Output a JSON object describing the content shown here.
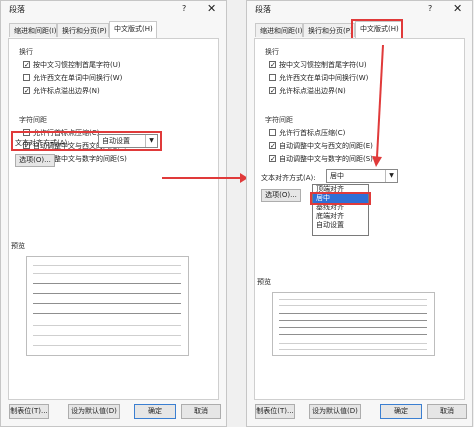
{
  "dialog_title": "段落",
  "help": "?",
  "close": "✕",
  "tabs": [
    "缩进和间距(I)",
    "换行和分页(P)",
    "中文版式(H)"
  ],
  "sections": {
    "line_break": "换行",
    "char_spacing": "字符间距",
    "preview": "预览"
  },
  "line_break_options": [
    {
      "label": "按中文习惯控制首尾字符(U)",
      "checked": true
    },
    {
      "label": "允许西文在单词中间换行(W)",
      "checked": false
    },
    {
      "label": "允许标点溢出边界(N)",
      "checked": true
    }
  ],
  "spacing_options": [
    {
      "label": "允许行首标点压缩(C)",
      "checked": false
    },
    {
      "label": "自动调整中文与西文的间距(E)",
      "checked": true
    },
    {
      "label": "自动调整中文与数字的间距(S)",
      "checked": true
    }
  ],
  "alignment_label": "文本对齐方式(A):",
  "alignment_value_left": "自动设置",
  "alignment_value_right": "居中",
  "options_button": "选项(O)...",
  "dropdown_items": [
    "顶端对齐",
    "居中",
    "基线对齐",
    "底端对齐",
    "自动设置"
  ],
  "dropdown_selected_index": 1,
  "buttons": {
    "tabs": "制表位(T)...",
    "default": "设为默认值(D)",
    "ok": "确定",
    "cancel": "取消"
  },
  "colors": {
    "highlight": "#e03a3a",
    "selection": "#2f6fd6"
  }
}
